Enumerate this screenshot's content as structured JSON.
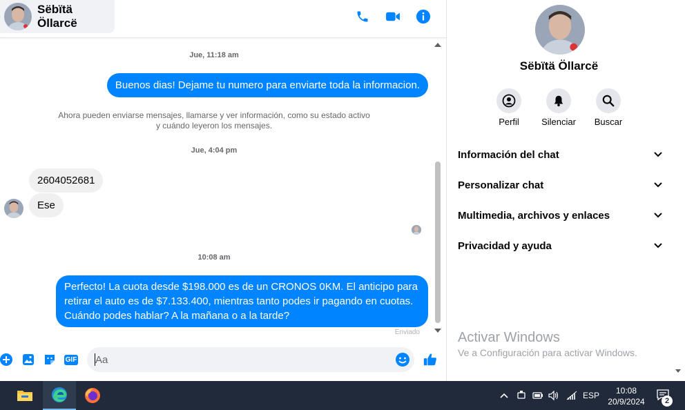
{
  "header": {
    "contact_name": "Sëbïtä Öllarcë",
    "icons": [
      "phone-icon",
      "video-icon",
      "info-icon"
    ]
  },
  "colors": {
    "messenger_blue": "#0084ff",
    "incoming_bubble": "#f0f0f0",
    "taskbar": "#202a3a"
  },
  "messages": {
    "timestamp_1": "Jue, 11:18 am",
    "msg_1": "Buenos dias! Dejame tu numero para enviarte toda la informacion.",
    "system_note": "Ahora pueden enviarse mensajes, llamarse y ver información, como su estado activo y cuándo leyeron los mensajes.",
    "timestamp_2": "Jue, 4:04 pm",
    "msg_2": "2604052681",
    "msg_3": "Ese",
    "timestamp_3": "10:08 am",
    "msg_4": "Perfecto! La cuota desde $198.000 es de un CRONOS 0KM. El anticipo para retirar el auto es de $7.133.400, mientras tanto podes ir pagando en cuotas. Cuándo podes hablar? A la mañana o a la tarde?",
    "status": "Enviado"
  },
  "composer": {
    "placeholder": "Aa",
    "icons": [
      "plus-icon",
      "photo-icon",
      "sticker-icon",
      "gif-icon",
      "emoji-icon",
      "like-icon"
    ],
    "gif_label": "GIF"
  },
  "info_pane": {
    "name": "Sëbïtä Öllarcë",
    "actions": [
      {
        "label": "Perfil",
        "icon": "profile-icon"
      },
      {
        "label": "Silenciar",
        "icon": "bell-icon"
      },
      {
        "label": "Buscar",
        "icon": "search-icon"
      }
    ],
    "sections": [
      "Información del chat",
      "Personalizar chat",
      "Multimedia, archivos y enlaces",
      "Privacidad y ayuda"
    ],
    "watermark_title": "Activar Windows",
    "watermark_subtitle": "Ve a Configuración para activar Windows."
  },
  "taskbar": {
    "apps": [
      "file-explorer-icon",
      "edge-icon",
      "firefox-icon"
    ],
    "language": "ESP",
    "time": "10:08",
    "date": "20/9/2024",
    "notification_count": "2"
  }
}
